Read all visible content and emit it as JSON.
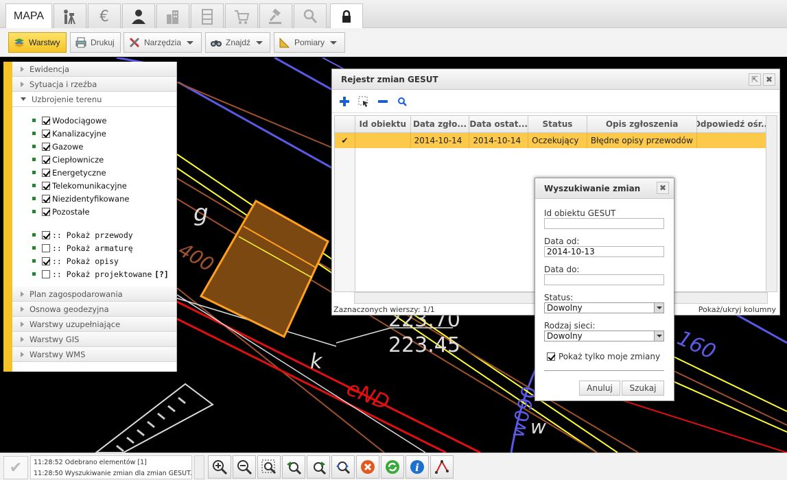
{
  "top_tabs": [
    {
      "label": "MAPA",
      "icon": "map-label"
    },
    {
      "icon": "surveyor-icon"
    },
    {
      "icon": "euro-icon"
    },
    {
      "icon": "person-icon"
    },
    {
      "icon": "buildings-icon"
    },
    {
      "icon": "cabinet-icon"
    },
    {
      "icon": "cart-icon"
    },
    {
      "icon": "gavel-icon"
    },
    {
      "icon": "search-icon"
    },
    {
      "icon": "lock-icon"
    }
  ],
  "toolbar": {
    "warstwy": "Warstwy",
    "drukuj": "Drukuj",
    "narzedzia": "Narzędzia",
    "znajdz": "Znajdź",
    "pomiary": "Pomiary"
  },
  "layers_panel": {
    "sections_top": [
      "Ewidencja",
      "Sytuacja i rzeźba"
    ],
    "open_section": "Uzbrojenie terenu",
    "networks": [
      {
        "label": "Wodociągowe",
        "checked": true
      },
      {
        "label": "Kanalizacyjne",
        "checked": true
      },
      {
        "label": "Gazowe",
        "checked": true
      },
      {
        "label": "Ciepłownicze",
        "checked": true
      },
      {
        "label": "Energetyczne",
        "checked": true
      },
      {
        "label": "Telekomunikacyjne",
        "checked": true
      },
      {
        "label": "Niezidentyfikowane",
        "checked": true
      },
      {
        "label": "Pozostałe",
        "checked": true
      }
    ],
    "options": [
      {
        "label": ":: Pokaż przewody",
        "checked": true
      },
      {
        "label": ":: Pokaż armaturę",
        "checked": false
      },
      {
        "label": ":: Pokaż opisy",
        "checked": true
      },
      {
        "label": ":: Pokaż projektowane",
        "checked": false,
        "help": "[?]"
      }
    ],
    "sections_bottom": [
      "Plan zagospodarowania",
      "Osnowa geodezyjna",
      "Warstwy uzupełniające",
      "Warstwy GIS",
      "Warstwy WMS"
    ]
  },
  "map_labels": {
    "g": "g",
    "k": "k",
    "w": "w",
    "num400": "400",
    "elev1": "223.70",
    "elev2": "223.45",
    "end": "eND",
    "num160": "160",
    "w090": "w090"
  },
  "gesut_window": {
    "title": "Rejestr zmian GESUT",
    "columns": [
      "Id obiektu",
      "Data zgło...",
      "Data ostat...",
      "Status",
      "Opis zgłoszenia",
      "Odpowiedź ośr..."
    ],
    "rows": [
      {
        "id": "",
        "data_zgl": "2014-10-14",
        "data_ost": "2014-10-14",
        "status": "Oczekujący",
        "opis": "Błędne opisy przewodów",
        "odp": ""
      }
    ],
    "footer_left": "Zaznaczonych wierszy: 1/1",
    "footer_right": "Pokaż/ukryj kolumny"
  },
  "search_dialog": {
    "title": "Wyszukiwanie zmian",
    "id_label": "Id obiektu GESUT",
    "id_value": "",
    "date_from_label": "Data od:",
    "date_from_value": "2014-10-13",
    "date_to_label": "Data do:",
    "date_to_value": "",
    "status_label": "Status:",
    "status_value": "Dowolny",
    "network_label": "Rodzaj sieci:",
    "network_value": "Dowolny",
    "only_mine_label": "Pokaż tylko moje zmiany",
    "only_mine_checked": true,
    "cancel": "Anuluj",
    "search": "Szukaj"
  },
  "status_log": [
    "11:28:52 Odebrano elementów [1]",
    "11:28:50 Wyszukiwanie zmian dla zmian GESUT..."
  ],
  "map_tools": [
    "zoom-in-icon",
    "zoom-out-icon",
    "zoom-window-icon",
    "zoom-previous-icon",
    "zoom-next-icon",
    "zoom-extent-icon",
    "cancel-icon",
    "refresh-icon",
    "info-icon",
    "measure-icon"
  ]
}
